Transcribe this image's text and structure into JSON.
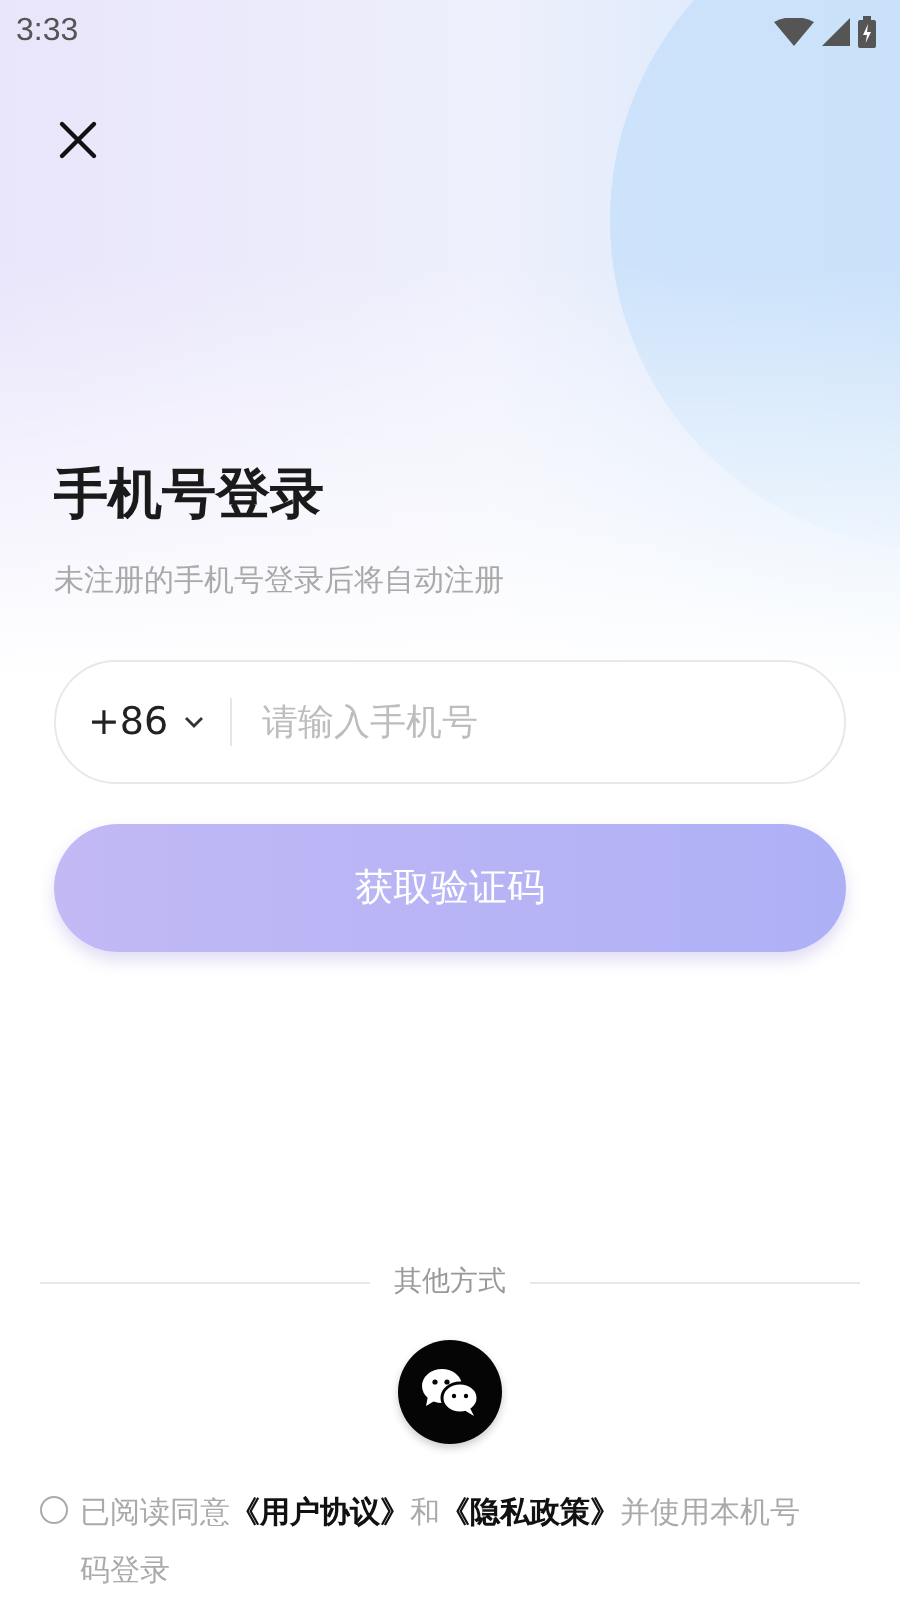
{
  "status_bar": {
    "time": "3:33"
  },
  "title": "手机号登录",
  "subtitle": "未注册的手机号登录后将自动注册",
  "phone_field": {
    "country_code": "+86",
    "placeholder": "请输入手机号"
  },
  "submit_button": {
    "label": "获取验证码",
    "disabled": true
  },
  "other_methods": {
    "label": "其他方式"
  },
  "agreement": {
    "checked": false,
    "parts": [
      {
        "kind": "text",
        "text": "已阅读同意"
      },
      {
        "kind": "link",
        "text": "《用户协议》"
      },
      {
        "kind": "text",
        "text": "和"
      },
      {
        "kind": "link",
        "text": "《隐私政策》"
      },
      {
        "kind": "text",
        "text": "并使用本机号码登录"
      }
    ]
  }
}
